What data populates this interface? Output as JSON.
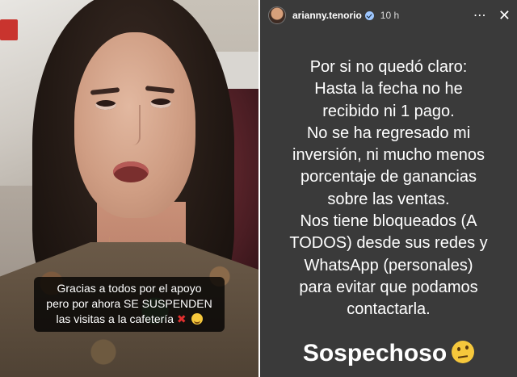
{
  "left_story": {
    "caption_lines": [
      "Gracias a todos por el apoyo",
      "pero por ahora SE SUSPENDEN",
      "las visitas a la cafetería"
    ],
    "caption_icons": [
      "cross-mark-icon",
      "smile-emoji-icon"
    ]
  },
  "right_story": {
    "header": {
      "username": "arianny.tenorio",
      "time": "10 h",
      "more_icon": "⋯",
      "close_icon": "✕"
    },
    "text_lines": [
      "Por si no quedó claro:",
      "Hasta la fecha no he",
      "recibido ni 1 pago.",
      "No se ha regresado mi",
      "inversión, ni mucho menos",
      "porcentaje de ganancias",
      "sobre las ventas.",
      "Nos tiene bloqueados (A",
      "TODOS) desde sus redes y",
      "WhatsApp (personales)",
      "para evitar que podamos",
      "contactarla."
    ],
    "footer_word": "Sospechoso",
    "footer_icon": "raised-eyebrow-emoji-icon"
  },
  "colors": {
    "right_background": "#3a3a3a",
    "divider": "#ffffff",
    "caption_background": "rgba(0,0,0,0.78)",
    "cross_mark": "#e0302f"
  }
}
